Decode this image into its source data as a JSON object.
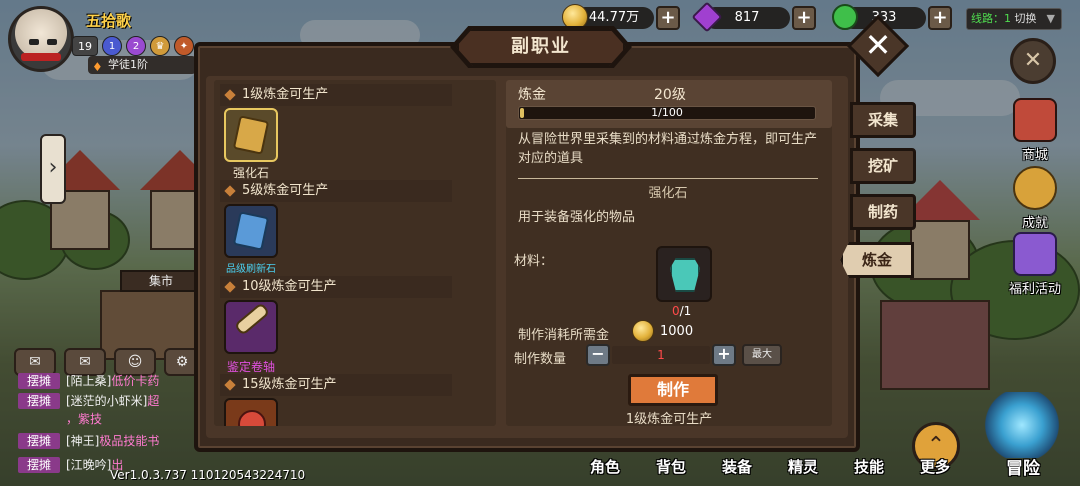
{
  "player": {
    "name": "五拾歌",
    "level": "19",
    "badge_1": "1",
    "badge_2": "2",
    "rank": "学徒1阶"
  },
  "resources": {
    "gold": "44.77万",
    "gems": "817",
    "stamina": "333"
  },
  "server_line": {
    "prefix": "线路：",
    "value": "1",
    "switch_label": "切换"
  },
  "side_menu": {
    "shop": "商城",
    "achievement": "成就",
    "welfare": "福利活动"
  },
  "left": {
    "market": "集市"
  },
  "chat": [
    {
      "tag": "摆摊",
      "who": "[陌上桑]",
      "msg": "低价卡药"
    },
    {
      "tag": "摆摊",
      "who": "[迷茫的小虾米]",
      "msg": "超"
    },
    {
      "tag": "",
      "who": "",
      "msg": "，紫技"
    },
    {
      "tag": "摆摊",
      "who": "[神王]",
      "msg": "极品技能书"
    },
    {
      "tag": "摆摊",
      "who": "[江晚吟]",
      "msg": "出"
    }
  ],
  "version": "Ver1.0.3.737  110120543224710",
  "bottom_menu": {
    "role": "角色",
    "bag": "背包",
    "equip": "装备",
    "spirit": "精灵",
    "skill": "技能",
    "more": "更多",
    "adventure": "冒险"
  },
  "panel": {
    "title": "副职业",
    "recipes": [
      {
        "header": "1级炼金可生产",
        "item": "强化石"
      },
      {
        "header": "5级炼金可生产",
        "item": "品级刷新石"
      },
      {
        "header": "10级炼金可生产",
        "item": "鉴定卷轴"
      },
      {
        "header": "15级炼金可生产",
        "item": ""
      }
    ],
    "skill_name": "炼金",
    "skill_level": "20级",
    "progress_text": "1/100",
    "progress_fraction": 0.01,
    "description": "从冒险世界里采集到的材料通过炼金方程，即可生产对应的道具",
    "selected_item": "强化石",
    "selected_item_desc": "用于装备强化的物品",
    "materials_label": "材料：",
    "material_have": "0",
    "material_need": "/1",
    "cost_label": "制作消耗所需金",
    "cost_value": "1000",
    "quantity_label": "制作数量",
    "quantity_value": "1",
    "max_label": "最大",
    "make_label": "制作",
    "make_note": "1级炼金可生产"
  },
  "tabs": [
    {
      "label": "采集",
      "active": false
    },
    {
      "label": "挖矿",
      "active": false
    },
    {
      "label": "制药",
      "active": false
    },
    {
      "label": "炼金",
      "active": true
    }
  ],
  "colors": {
    "panel_bg": "#3a2a1f",
    "accent_orange": "#e07a3a",
    "gold": "#ffd24a",
    "chat_tag": "#8a3a8a",
    "chat_message": "#ff7bd0"
  }
}
